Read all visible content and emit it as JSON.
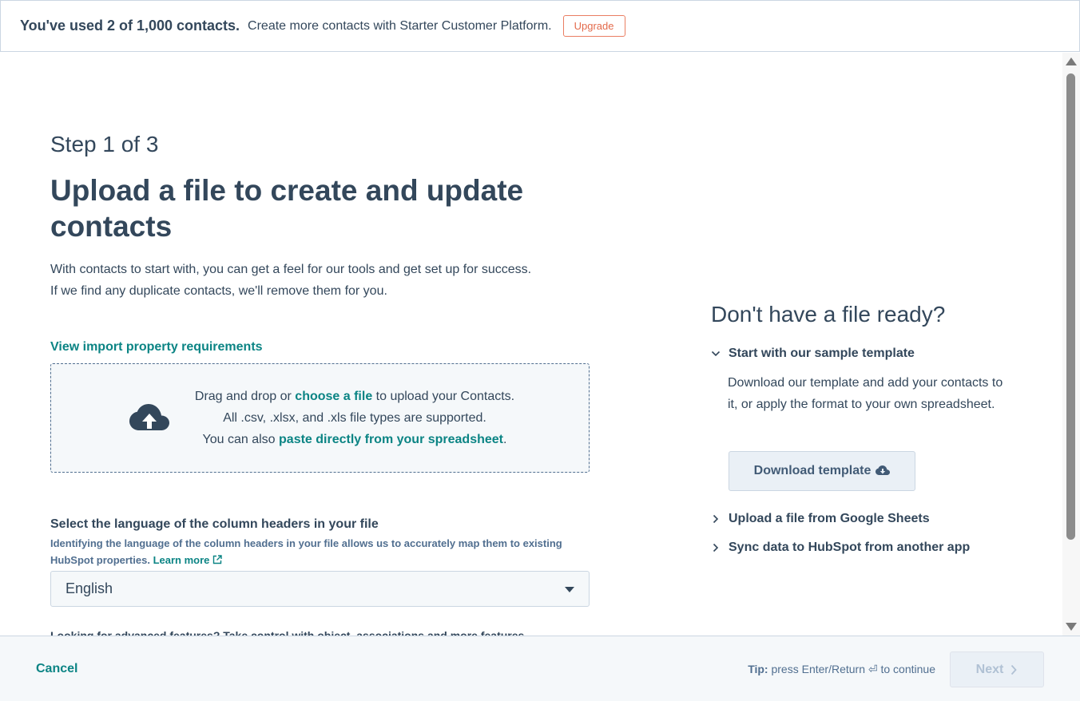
{
  "banner": {
    "usage": "You've used 2 of 1,000 contacts.",
    "message": "Create more contacts with Starter Customer Platform.",
    "upgrade_label": "Upgrade"
  },
  "main": {
    "step": "Step 1 of 3",
    "title": "Upload a file to create and update contacts",
    "intro_line1": "With contacts to start with, you can get a feel for our tools and get set up for success.",
    "intro_line2": "If we find any duplicate contacts, we'll remove them for you.",
    "requirements_link": "View import property requirements",
    "dropzone": {
      "line1_prefix": "Drag and drop or ",
      "line1_link": "choose a file",
      "line1_suffix": " to upload your Contacts.",
      "line2": "All .csv, .xlsx, and .xls file types are supported.",
      "line3_prefix": "You can also ",
      "line3_link": "paste directly from your spreadsheet",
      "line3_suffix": "."
    },
    "language": {
      "label": "Select the language of the column headers in your file",
      "help": "Identifying the language of the column headers in your file allows us to accurately map them to existing HubSpot properties.",
      "learn_more": "Learn more",
      "selected": "English"
    },
    "cutoff_text": "Looking for advanced features? Take control with object, associations and more features"
  },
  "sidebar": {
    "title": "Don't have a file ready?",
    "template_heading": "Start with our sample template",
    "template_body": "Download our template and add your contacts to it, or apply the format to your own spreadsheet.",
    "download_label": "Download template",
    "sheets_heading": "Upload a file from Google Sheets",
    "sync_heading": "Sync data to HubSpot from another app"
  },
  "footer": {
    "cancel_label": "Cancel",
    "tip_label": "Tip:",
    "tip_text": "press Enter/Return ⏎ to continue",
    "next_label": "Next"
  },
  "icons": {
    "upload": "cloud-upload-icon",
    "download": "cloud-download-icon",
    "external": "external-link-icon",
    "expand": "chevron-down-icon",
    "collapse": "chevron-right-icon"
  },
  "colors": {
    "link": "#0b8484",
    "text": "#33475b",
    "upgrade": "#e36a4b",
    "panel_bg": "#f5f8fa"
  }
}
